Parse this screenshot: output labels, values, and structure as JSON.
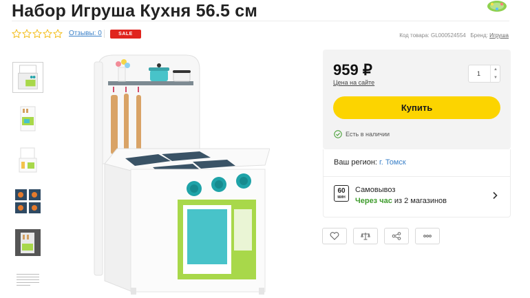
{
  "product": {
    "title": "Набор Игруша Кухня 56.5 см",
    "reviews_label": "Отзывы: 0",
    "sale_badge": "SALE",
    "sku_label": "Код товара:",
    "sku": "GL000524554",
    "brand_label": "Бренд:",
    "brand": "Игруша",
    "rating": 0,
    "rating_max": 5
  },
  "thumbnails": [
    "thumb-1",
    "thumb-2",
    "thumb-3",
    "thumb-4",
    "thumb-5",
    "thumb-6"
  ],
  "buy_panel": {
    "price": "959 ₽",
    "price_note": "Цена на сайте",
    "quantity": "1",
    "buy_label": "Купить",
    "stock_label": "Есть в наличии"
  },
  "delivery": {
    "region_label": "Ваш регион:",
    "region_city": "г. Томск",
    "pickup_minutes": "60",
    "pickup_unit": "МИН",
    "pickup_title": "Самовывоз",
    "pickup_time": "Через час",
    "pickup_stores": "из 2 магазинов"
  },
  "actions": [
    "favorite-icon",
    "compare-icon",
    "share-icon",
    "more-icon"
  ],
  "colors": {
    "accent_yellow": "#fcd400",
    "sale_red": "#e0241d",
    "link_blue": "#3a80c8",
    "stock_green": "#3d9b2b"
  }
}
